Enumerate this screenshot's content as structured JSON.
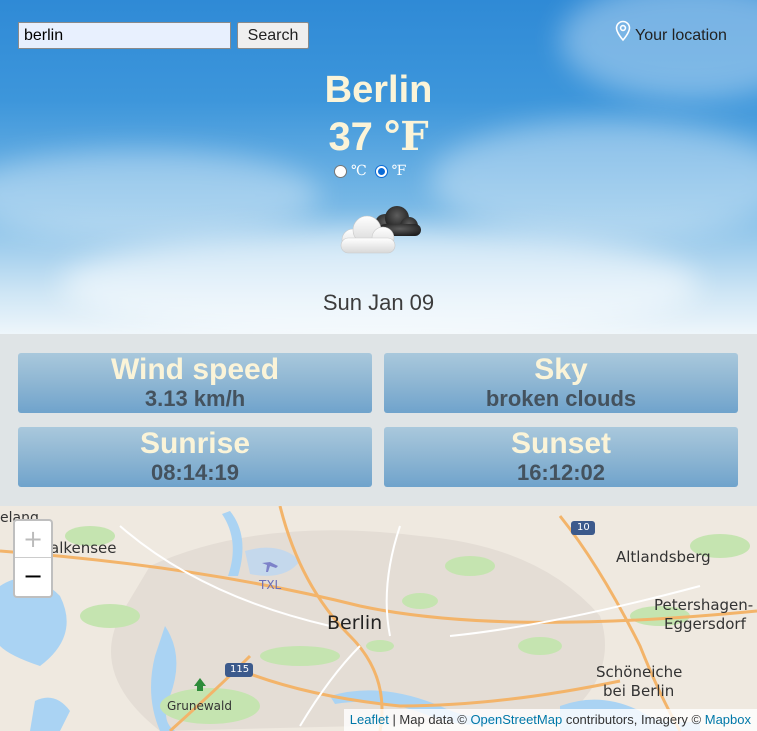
{
  "search": {
    "value": "berlin",
    "button_label": "Search"
  },
  "location": {
    "label": "Your location"
  },
  "weather": {
    "city": "Berlin",
    "temperature": "37",
    "unit_symbol": "℉",
    "units": [
      {
        "label": "℃",
        "selected": false
      },
      {
        "label": "℉",
        "selected": true
      }
    ],
    "icon": "broken-clouds-icon",
    "date": "Sun Jan 09"
  },
  "cards": [
    {
      "title": "Wind speed",
      "value": "3.13 km/h"
    },
    {
      "title": "Sky",
      "value": "broken clouds"
    },
    {
      "title": "Sunrise",
      "value": "08:14:19"
    },
    {
      "title": "Sunset",
      "value": "16:12:02"
    }
  ],
  "map": {
    "zoom_in": "+",
    "zoom_out": "−",
    "labels": {
      "falkensee": "alkensee",
      "nauen": "elang",
      "txl": "TXL",
      "altlandsberg": "Altlandsberg",
      "berlin": "Berlin",
      "petershagen_1": "Petershagen-",
      "petershagen_2": "Eggersdorf",
      "schoneiche_1": "Schöneiche",
      "schoneiche_2": "bei Berlin",
      "grunewald": "Grunewald",
      "route_10": "10",
      "route_115": "115"
    },
    "attribution": {
      "leaflet": "Leaflet",
      "sep": " | Map data © ",
      "osm": "OpenStreetMap",
      "mid": " contributors, Imagery © ",
      "mapbox": "Mapbox"
    }
  },
  "colors": {
    "accent_text": "#fbf4d8",
    "link": "#0078a8"
  }
}
